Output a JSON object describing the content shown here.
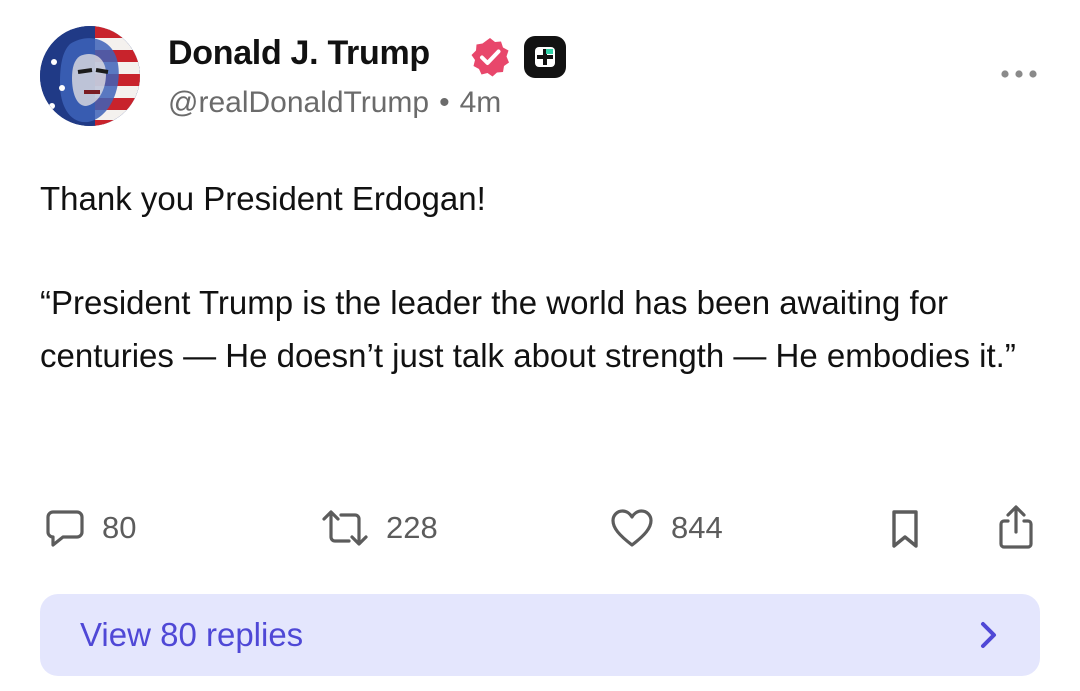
{
  "author": {
    "display_name": "Donald J. Trump",
    "handle": "@realDonaldTrump",
    "separator": "•",
    "time_ago": "4m",
    "verified": true
  },
  "post": {
    "paragraphs": [
      "Thank you President Erdogan!",
      "“President Trump is the leader the world has been awaiting for centuries — He doesn’t just talk about strength — He embodies it.”"
    ]
  },
  "actions": {
    "replies": "80",
    "reposts": "228",
    "likes": "844"
  },
  "replies_button": {
    "label": "View 80 replies"
  },
  "icons": {
    "avatar": "avatar-portrait",
    "verified": "verified-badge-icon",
    "plus": "plus-badge-icon",
    "more": "more-icon",
    "reply": "comment-icon",
    "repost": "repost-icon",
    "like": "heart-icon",
    "bookmark": "bookmark-icon",
    "share": "share-icon",
    "chevron": "chevron-right-icon"
  },
  "colors": {
    "text": "#111111",
    "muted": "#6b6b6b",
    "verified": "#e8476b",
    "replies_bg": "#e4e6fd",
    "replies_text": "#4f48d6"
  }
}
